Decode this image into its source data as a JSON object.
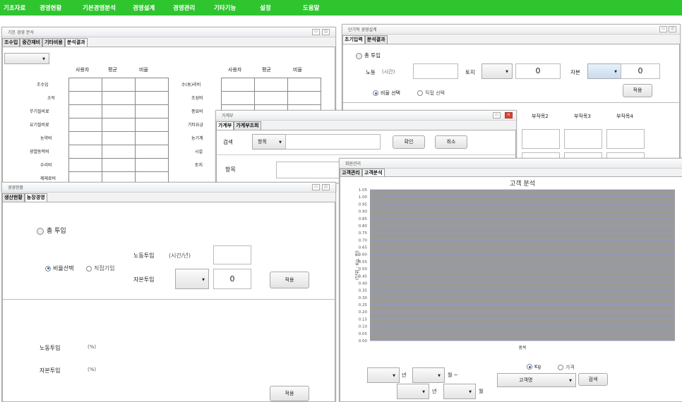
{
  "menu": [
    "기초자료",
    "경영현황",
    "기본경영분석",
    "경영설계",
    "경영관리",
    "기타기능",
    "설정",
    "도움말"
  ],
  "win_analysis": {
    "title": "기본 경영 분석",
    "tabs": [
      "조수입",
      "중간재비",
      "기타비용",
      "분석결과"
    ],
    "col_headers": [
      "사용자",
      "평균",
      "비율"
    ],
    "left_rows": [
      "조수입",
      "소득",
      "무기질비료",
      "유기질비료",
      "농약비",
      "광열동력비",
      "수리비",
      "제제료비"
    ],
    "right_rows": [
      "수(水)리비",
      "조성비",
      "종묘비",
      "기타요금",
      "농기계",
      "시설",
      "토지"
    ]
  },
  "win_short": {
    "title": "단기적 경영설계",
    "tabs": [
      "초기입력",
      "분석결과"
    ],
    "total_input": "총 투입",
    "labor_label": "노동",
    "labor_unit": "(시간)",
    "land_label": "토지",
    "land_value": "0",
    "capital_label": "자본",
    "capital_value": "0",
    "radio_ratio": "비율 선택",
    "radio_direct": "직접 선택",
    "apply_label": "적용",
    "sub_headers": [
      "부작목2",
      "부작목3",
      "부작목4"
    ]
  },
  "win_ledger": {
    "title": "가계부",
    "tabs": [
      "가계부",
      "가계부조회"
    ],
    "search_label": "검색",
    "search_field": "항목",
    "confirm_label": "확인",
    "cancel_label": "취소",
    "item_label": "항목"
  },
  "win_status": {
    "title": "경영현황",
    "tabs": [
      "생산현황",
      "농장경영"
    ],
    "total_input": "총 투입",
    "labor_input": "노동투입",
    "labor_unit": "(시간/년)",
    "capital_input": "자본투입",
    "capital_value": "0",
    "radio_ratio": "비율선택",
    "radio_direct": "직접기입",
    "apply_label": "적용",
    "labor_pct_label": "노동투입",
    "capital_pct_label": "자본투입",
    "pct_unit": "(%)",
    "apply2_label": "적용"
  },
  "win_customer": {
    "title": "회원관리",
    "tabs": [
      "고객관리",
      "고객분석"
    ],
    "radio_kg": "Kg",
    "radio_price": "가격",
    "year_label": "년",
    "month_label": "월 ~",
    "year2_label": "년",
    "month2_label": "월",
    "customer_combo": "고객명",
    "search_label": "검색"
  },
  "chart_data": {
    "type": "bar",
    "title": "고객 분석",
    "xlabel": "품목",
    "ylabel": "(단위 : Kg, 원)",
    "ylim": [
      0,
      1.05
    ],
    "y_ticks": [
      "0.00",
      "0.05",
      "0.10",
      "0.15",
      "0.20",
      "0.25",
      "0.30",
      "0.35",
      "0.40",
      "0.45",
      "0.50",
      "0.55",
      "0.60",
      "0.65",
      "0.70",
      "0.75",
      "0.80",
      "0.85",
      "0.90",
      "0.95",
      "1.00",
      "1.05"
    ],
    "categories": [],
    "values": [],
    "grid": true
  }
}
